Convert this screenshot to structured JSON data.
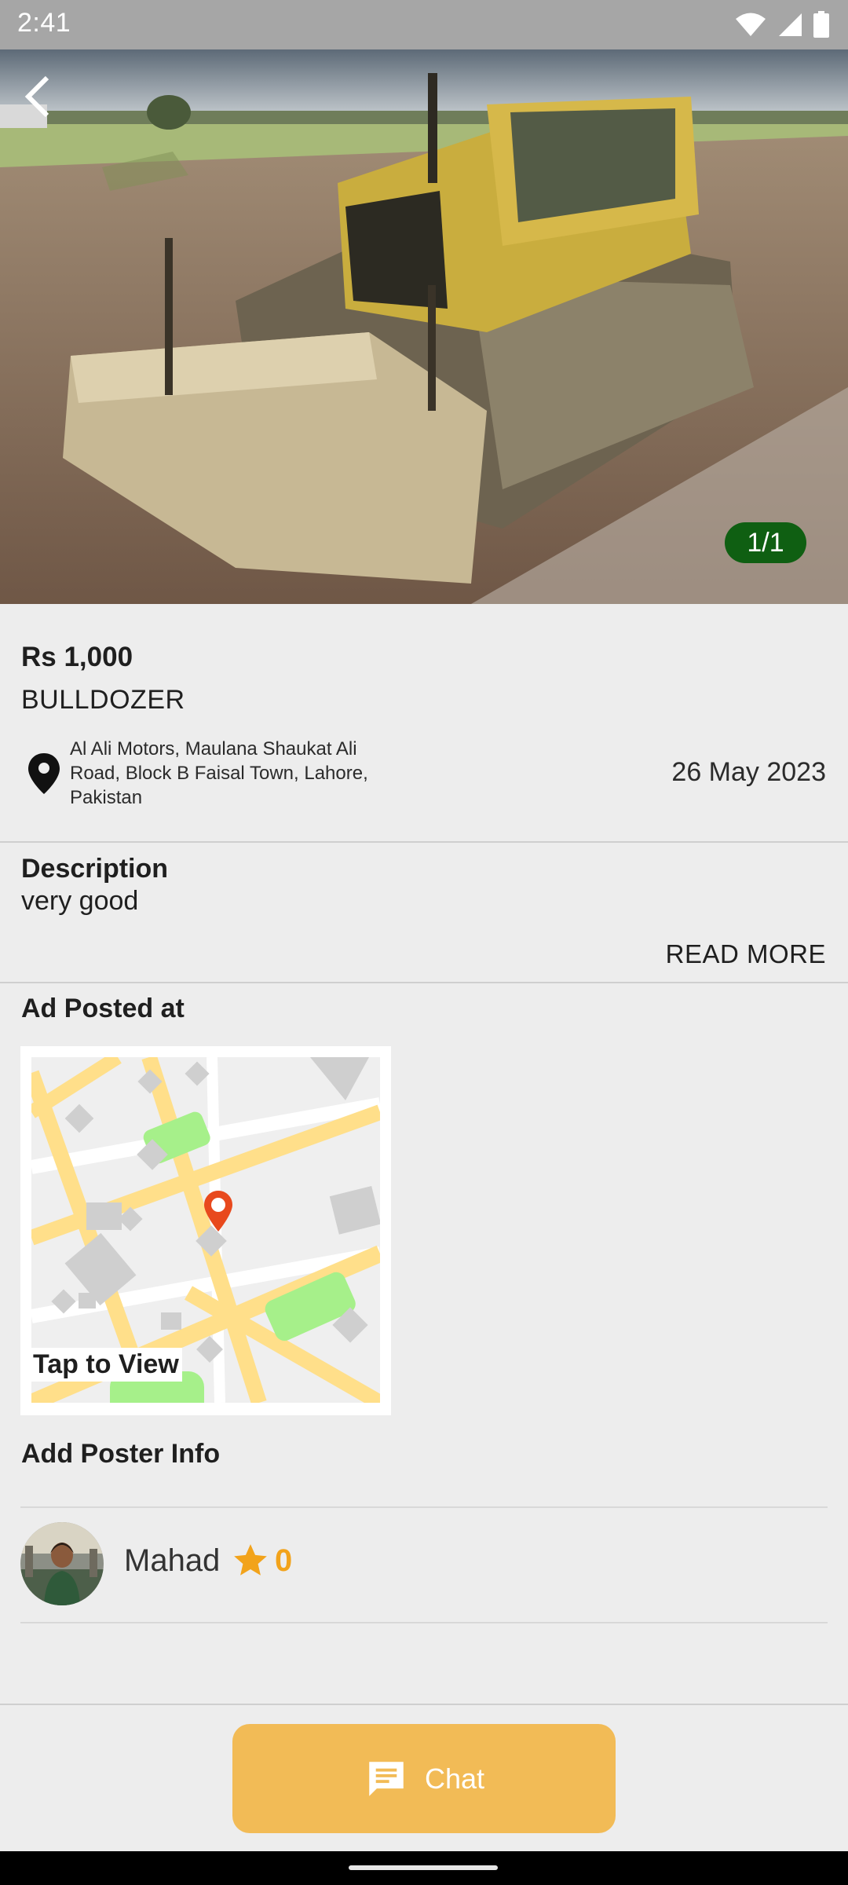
{
  "status_bar": {
    "time": "2:41"
  },
  "gallery": {
    "counter": "1/1"
  },
  "listing": {
    "price": "Rs 1,000",
    "title": "BULLDOZER",
    "address": "Al Ali Motors, Maulana Shaukat Ali Road, Block B Faisal Town, Lahore, Pakistan",
    "date": "26 May 2023"
  },
  "description": {
    "heading": "Description",
    "text": "very good",
    "read_more": "READ MORE"
  },
  "location": {
    "heading": "Ad Posted at",
    "tap_label": "Tap to View"
  },
  "poster": {
    "heading": "Add Poster Info",
    "name": "Mahad",
    "rating": "0"
  },
  "actions": {
    "chat_label": "Chat"
  },
  "colors": {
    "accent": "#f2bb56",
    "counter_bg": "#0f5f12",
    "star": "#f2a31b",
    "map_pin": "#e8491d"
  }
}
